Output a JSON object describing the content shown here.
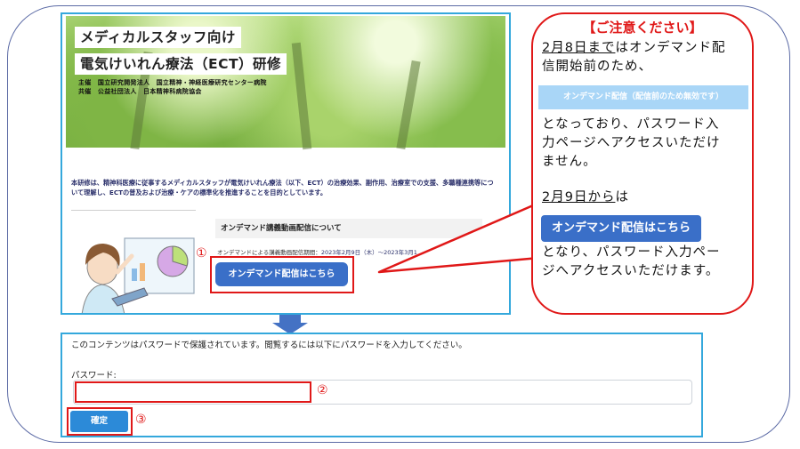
{
  "hero": {
    "title_line1": "メディカルスタッフ向け",
    "title_line2": "電気けいれん療法（ECT）研修",
    "org_line1": "主催　国立研究開発法人　国立精神・神経医療研究センター病院",
    "org_line2": "共催　公益社団法人　日本精神科病院協会"
  },
  "intro": {
    "text": "本研修は、精神科医療に従事するメディカルスタッフが電気けいれん療法（以下、ECT）の治療効果、副作用、治療室での支援、多職種連携等について理解し、ECTの普及および治療・ケアの標準化を推進することを目的としています。"
  },
  "ondemand_section": {
    "heading": "オンデマンド講義動画配信について",
    "period_label": "オンデマンドによる講義動画配信期間：",
    "period_value": "2023年2月9日（木）～2023年3月1",
    "button_label": "オンデマンド配信はこちら",
    "step_marker": "①"
  },
  "notice": {
    "title": "【ご注意ください】",
    "date1": "2月8日まで",
    "line1_rest": "はオンデマンド配",
    "line2": "信開始前のため、",
    "disabled_button": "オンデマンド配信（配信前のため無効です）",
    "line3": "となっており、パスワード入",
    "line4": "力ページへアクセスいただけ",
    "line5": "ません。",
    "date2": "2月9日から",
    "line6_rest": "は",
    "enabled_button": "オンデマンド配信はこちら",
    "line7": "となり、パスワード入力ペー",
    "line8": "ジへアクセスいただけます。"
  },
  "password_page": {
    "info_text": "このコンテンツはパスワードで保護されています。閲覧するには以下にパスワードを入力してください。",
    "password_label": "パスワード:",
    "password_value": "",
    "submit_label": "確定",
    "input_marker": "②",
    "submit_marker": "③"
  },
  "colors": {
    "frame": "#34a8dc",
    "highlight_red": "#e01818",
    "button_blue": "#3a6fc8",
    "disabled_blue": "#a9d6f7",
    "arrow_blue": "#4472c4"
  }
}
